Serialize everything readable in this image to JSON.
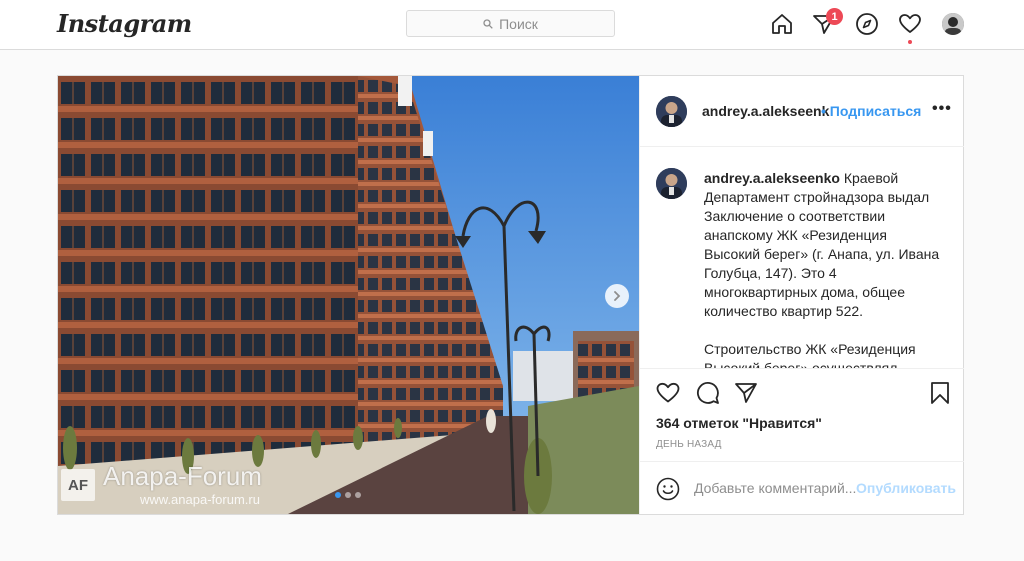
{
  "nav": {
    "logo": "Instagram",
    "search_placeholder": "Поиск",
    "activity_badge": "1",
    "icons": [
      "home-icon",
      "direct-icon",
      "explore-icon",
      "heart-icon",
      "profile-avatar"
    ]
  },
  "post": {
    "username": "andrey.a.alekseenk",
    "follow_label": "• Подписаться",
    "more_label": "•••",
    "caption_user": "andrey.a.alekseenko",
    "caption_p1": "Краевой Департамент стройнадзора выдал Заключение о соответствии анапскому ЖК «Резиденция Высокий берег» (г. Анапа, ул. Ивана Голубца, 147). Это 4 многоквартирных дома, общее количество квартир 522.",
    "caption_p2": "Строительство ЖК «Резиденция Высокий берег» осуществлял застройщик ООО «Газпром",
    "likes": "364 отметок \"Нравится\"",
    "time": "ДЕНЬ НАЗАД",
    "comment_placeholder": "Добавьте комментарий...",
    "publish_label": "Опубликовать",
    "carousel": {
      "slides": 3,
      "active": 1
    },
    "watermark": {
      "title": "Anapa-Forum",
      "url": "www.anapa-forum.ru",
      "logo": "AF"
    }
  },
  "colors": {
    "accent": "#3897f0",
    "badge": "#ed4956",
    "publish_disabled": "#b3dbff"
  }
}
